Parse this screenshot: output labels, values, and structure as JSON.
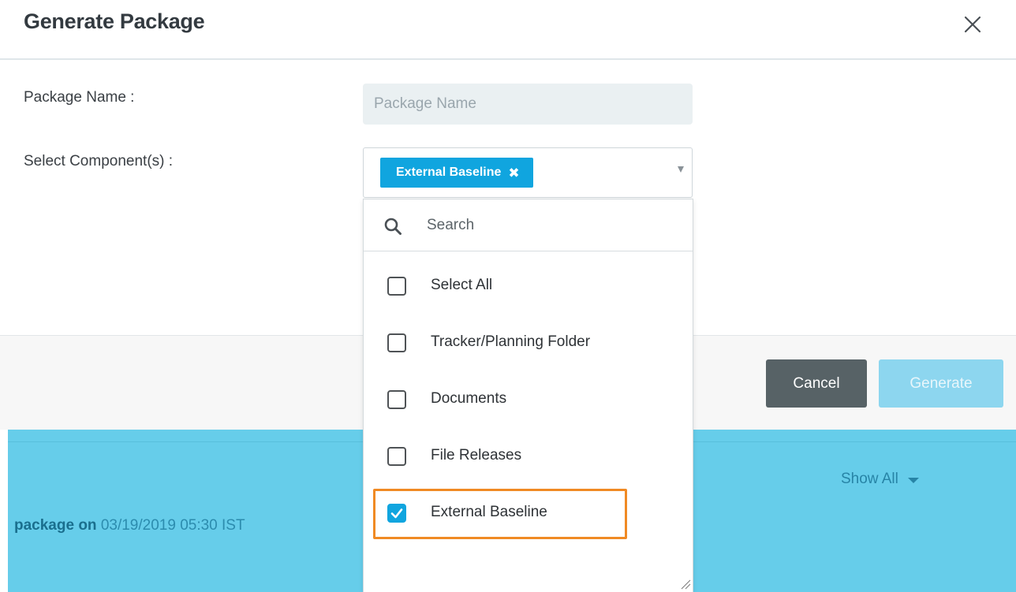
{
  "modal": {
    "title": "Generate Package",
    "close_icon": "close-icon"
  },
  "form": {
    "package_name_label": "Package Name :",
    "package_name_placeholder": "Package Name",
    "package_name_value": "",
    "components_label": "Select Component(s) :",
    "selected_tags": [
      "External Baseline"
    ]
  },
  "dropdown": {
    "search_placeholder": "Search",
    "options": [
      {
        "label": "Select All",
        "checked": false
      },
      {
        "label": "Tracker/Planning Folder",
        "checked": false
      },
      {
        "label": "Documents",
        "checked": false
      },
      {
        "label": "File Releases",
        "checked": false
      },
      {
        "label": "External Baseline",
        "checked": true
      }
    ]
  },
  "footer": {
    "cancel_label": "Cancel",
    "generate_label": "Generate"
  },
  "background": {
    "history_prefix": "package on",
    "history_timestamp": "03/19/2019 05:30 IST",
    "show_all_label": "Show All"
  },
  "colors": {
    "accent": "#10a5df",
    "band": "#66cdea",
    "cancel_button": "#576266",
    "generate_button_disabled": "#8dd6ef",
    "highlight_outline": "#f08a24"
  }
}
